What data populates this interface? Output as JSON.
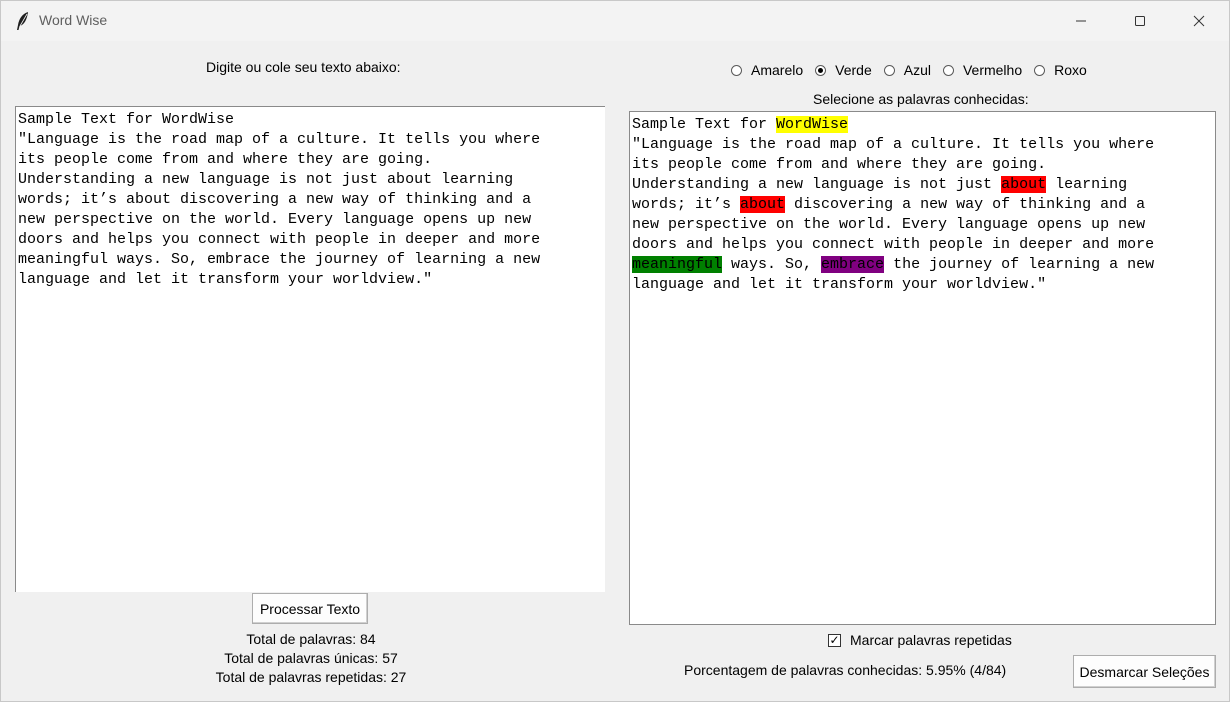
{
  "window": {
    "title": "Word Wise",
    "controls": {
      "minimize": "minimize",
      "maximize": "maximize",
      "close": "close"
    }
  },
  "left_panel": {
    "label": "Digite ou cole seu texto abaixo:",
    "text": "Sample Text for WordWise\n\"Language is the road map of a culture. It tells you where\nits people come from and where they are going.\nUnderstanding a new language is not just about learning\nwords; it’s about discovering a new way of thinking and a\nnew perspective on the world. Every language opens up new\ndoors and helps you connect with people in deeper and more\nmeaningful ways. So, embrace the journey of learning a new\nlanguage and let it transform your worldview.\"",
    "process_button": "Processar Texto",
    "stats": {
      "total_words": "Total de palavras: 84",
      "unique_words": "Total de palavras únicas: 57",
      "repeated_words": "Total de palavras repetidas: 27"
    }
  },
  "right_panel": {
    "color_options": [
      {
        "label": "Amarelo",
        "selected": false
      },
      {
        "label": "Verde",
        "selected": true
      },
      {
        "label": "Azul",
        "selected": false
      },
      {
        "label": "Vermelho",
        "selected": false
      },
      {
        "label": "Roxo",
        "selected": false
      }
    ],
    "label": "Selecione as palavras conhecidas:",
    "text": {
      "l1_pre": "Sample Text for ",
      "l1_hl": "WordWise",
      "l2": "\"Language is the road map of a culture. It tells you where",
      "l3": "its people come from and where they are going.",
      "l4_pre": "Understanding a new language is not just ",
      "l4_hl": "about",
      "l4_post": " learning",
      "l5_pre": "words; it’s ",
      "l5_hl": "about",
      "l5_post": " discovering a new way of thinking and a",
      "l6": "new perspective on the world. Every language opens up new",
      "l7": "doors and helps you connect with people in deeper and more",
      "l8_hl1": "meaningful",
      "l8_mid": " ways. So, ",
      "l8_hl2": "embrace",
      "l8_post": " the journey of learning a new",
      "l9": "language and let it transform your worldview.\""
    },
    "highlight_colors": {
      "yellow": "#ffff00",
      "red": "#ff0000",
      "green": "#008000",
      "purple": "#800080"
    },
    "checkbox_label": "Marcar palavras repetidas",
    "checkbox_checked": true,
    "percentage": "Porcentagem de palavras conhecidas: 5.95% (4/84)",
    "clear_button": "Desmarcar Seleções"
  }
}
